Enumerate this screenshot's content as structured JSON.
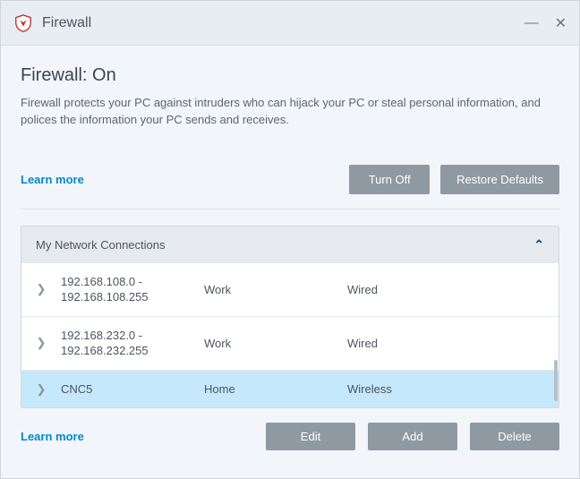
{
  "title": "Firewall",
  "header": {
    "heading": "Firewall: On",
    "description": "Firewall protects your PC against intruders who can hijack your PC or steal personal information, and polices the information your PC sends and receives.",
    "learn_more": "Learn more",
    "turn_off": "Turn Off",
    "restore_defaults": "Restore Defaults"
  },
  "panel": {
    "title": "My Network Connections",
    "rows": [
      {
        "name": "192.168.108.0 - 192.168.108.255",
        "type": "Work",
        "conn": "Wired"
      },
      {
        "name": "192.168.232.0 - 192.168.232.255",
        "type": "Work",
        "conn": "Wired"
      },
      {
        "name": "CNC5",
        "type": "Home",
        "conn": "Wireless"
      }
    ]
  },
  "footer": {
    "learn_more": "Learn more",
    "edit": "Edit",
    "add": "Add",
    "delete": "Delete"
  }
}
